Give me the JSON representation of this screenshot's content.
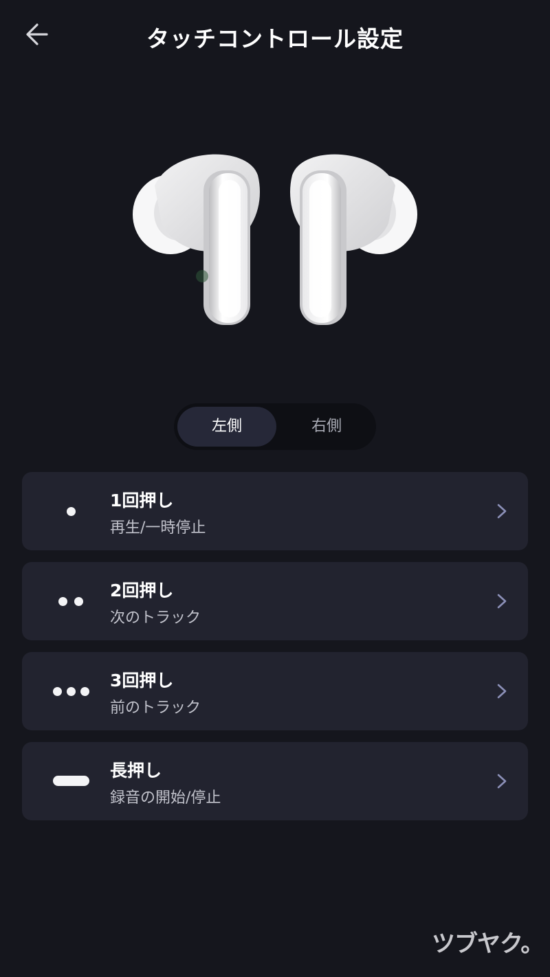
{
  "header": {
    "title": "タッチコントロール設定"
  },
  "segments": {
    "left_label": "左側",
    "right_label": "右側",
    "selected": "左側"
  },
  "actions": [
    {
      "title": "1回押し",
      "subtitle": "再生/一時停止",
      "indicator": "one-dot-icon"
    },
    {
      "title": "2回押し",
      "subtitle": "次のトラック",
      "indicator": "two-dots-icon"
    },
    {
      "title": "3回押し",
      "subtitle": "前のトラック",
      "indicator": "three-dots-icon"
    },
    {
      "title": "長押し",
      "subtitle": "録音の開始/停止",
      "indicator": "long-bar-icon"
    }
  ],
  "watermark": "ツブヤク。",
  "colors": {
    "background": "#15161d",
    "card": "#22232f",
    "segment_active": "#262838",
    "chevron": "#8c90b8"
  }
}
